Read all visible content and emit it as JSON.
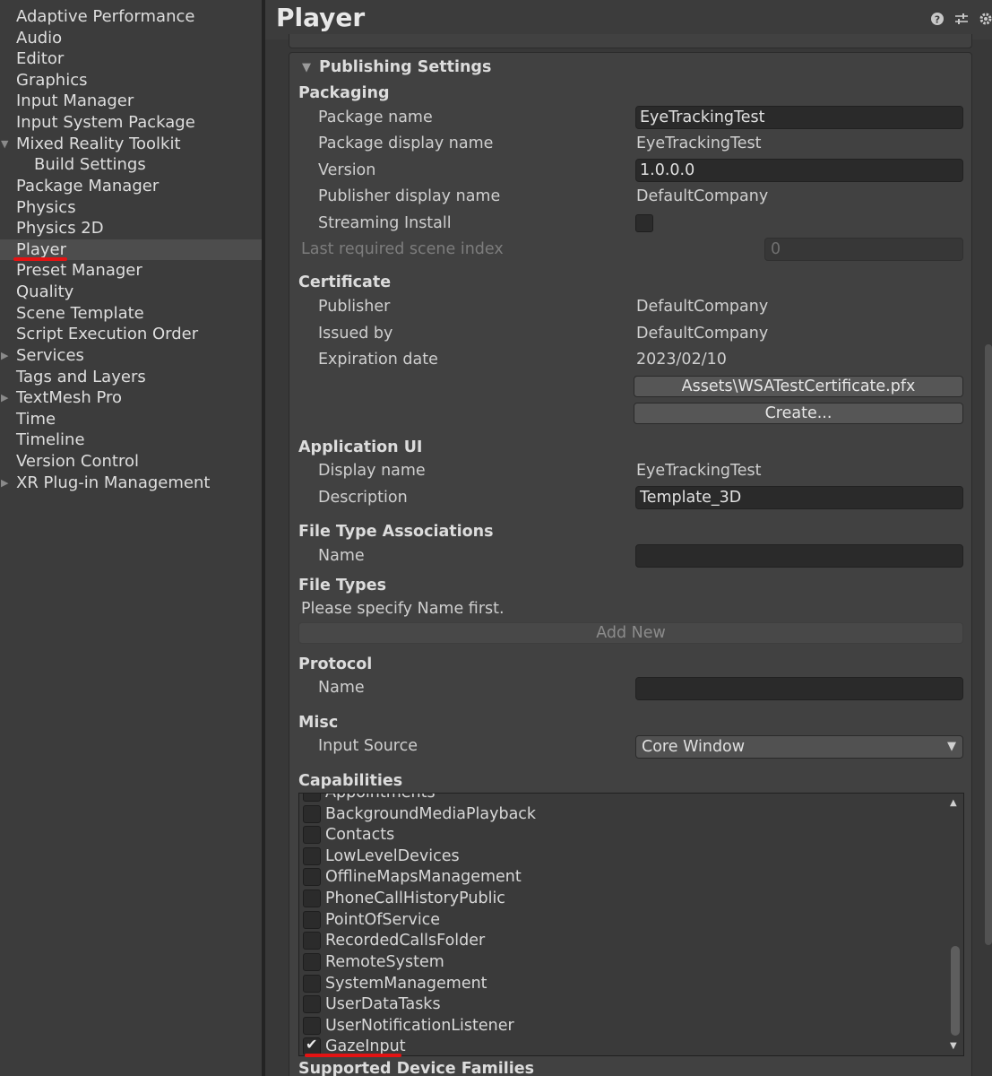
{
  "sidebar": {
    "items": [
      {
        "label": "Adaptive Performance"
      },
      {
        "label": "Audio"
      },
      {
        "label": "Editor"
      },
      {
        "label": "Graphics"
      },
      {
        "label": "Input Manager"
      },
      {
        "label": "Input System Package"
      },
      {
        "label": "Mixed Reality Toolkit",
        "expanded": true
      },
      {
        "label": "Build Settings"
      },
      {
        "label": "Package Manager"
      },
      {
        "label": "Physics"
      },
      {
        "label": "Physics 2D"
      },
      {
        "label": "Player",
        "selected": true
      },
      {
        "label": "Preset Manager"
      },
      {
        "label": "Quality"
      },
      {
        "label": "Scene Template"
      },
      {
        "label": "Script Execution Order"
      },
      {
        "label": "Services"
      },
      {
        "label": "Tags and Layers"
      },
      {
        "label": "TextMesh Pro"
      },
      {
        "label": "Time"
      },
      {
        "label": "Timeline"
      },
      {
        "label": "Version Control"
      },
      {
        "label": "XR Plug-in Management"
      }
    ]
  },
  "header": {
    "title": "Player",
    "icons": [
      "help-icon",
      "preset-sliders-icon",
      "gear-icon"
    ]
  },
  "publishing": {
    "foldout_label": "Publishing Settings",
    "packaging": {
      "heading": "Packaging",
      "package_name_label": "Package name",
      "package_name_value": "EyeTrackingTest",
      "display_name_label": "Package display name",
      "display_name_value": "EyeTrackingTest",
      "version_label": "Version",
      "version_value": "1.0.0.0",
      "publisher_display_label": "Publisher display name",
      "publisher_display_value": "DefaultCompany",
      "streaming_install_label": "Streaming Install",
      "streaming_install_checked": false,
      "last_scene_label": "Last required scene index",
      "last_scene_value": "0"
    },
    "certificate": {
      "heading": "Certificate",
      "publisher_label": "Publisher",
      "publisher_value": "DefaultCompany",
      "issued_by_label": "Issued by",
      "issued_by_value": "DefaultCompany",
      "expiration_label": "Expiration date",
      "expiration_value": "2023/02/10",
      "cert_file_button": "Assets\\WSATestCertificate.pfx",
      "create_button": "Create..."
    },
    "application_ui": {
      "heading": "Application UI",
      "display_name_label": "Display name",
      "display_name_value": "EyeTrackingTest",
      "description_label": "Description",
      "description_value": "Template_3D"
    },
    "file_type_assoc": {
      "heading": "File Type Associations",
      "name_label": "Name",
      "name_value": ""
    },
    "file_types": {
      "heading": "File Types",
      "hint": "Please specify Name first.",
      "add_new_button": "Add New"
    },
    "protocol": {
      "heading": "Protocol",
      "name_label": "Name",
      "name_value": ""
    },
    "misc": {
      "heading": "Misc",
      "input_source_label": "Input Source",
      "input_source_value": "Core Window"
    },
    "capabilities": {
      "heading": "Capabilities",
      "items": [
        {
          "label": "Appointments",
          "checked": false
        },
        {
          "label": "BackgroundMediaPlayback",
          "checked": false
        },
        {
          "label": "Contacts",
          "checked": false
        },
        {
          "label": "LowLevelDevices",
          "checked": false
        },
        {
          "label": "OfflineMapsManagement",
          "checked": false
        },
        {
          "label": "PhoneCallHistoryPublic",
          "checked": false
        },
        {
          "label": "PointOfService",
          "checked": false
        },
        {
          "label": "RecordedCallsFolder",
          "checked": false
        },
        {
          "label": "RemoteSystem",
          "checked": false
        },
        {
          "label": "SystemManagement",
          "checked": false
        },
        {
          "label": "UserDataTasks",
          "checked": false
        },
        {
          "label": "UserNotificationListener",
          "checked": false
        },
        {
          "label": "GazeInput",
          "checked": true
        }
      ]
    },
    "supported_device_families_heading": "Supported Device Families"
  },
  "colors": {
    "highlight_underline": "#e41313",
    "background": "#383838",
    "field": "#2a2a2a"
  }
}
